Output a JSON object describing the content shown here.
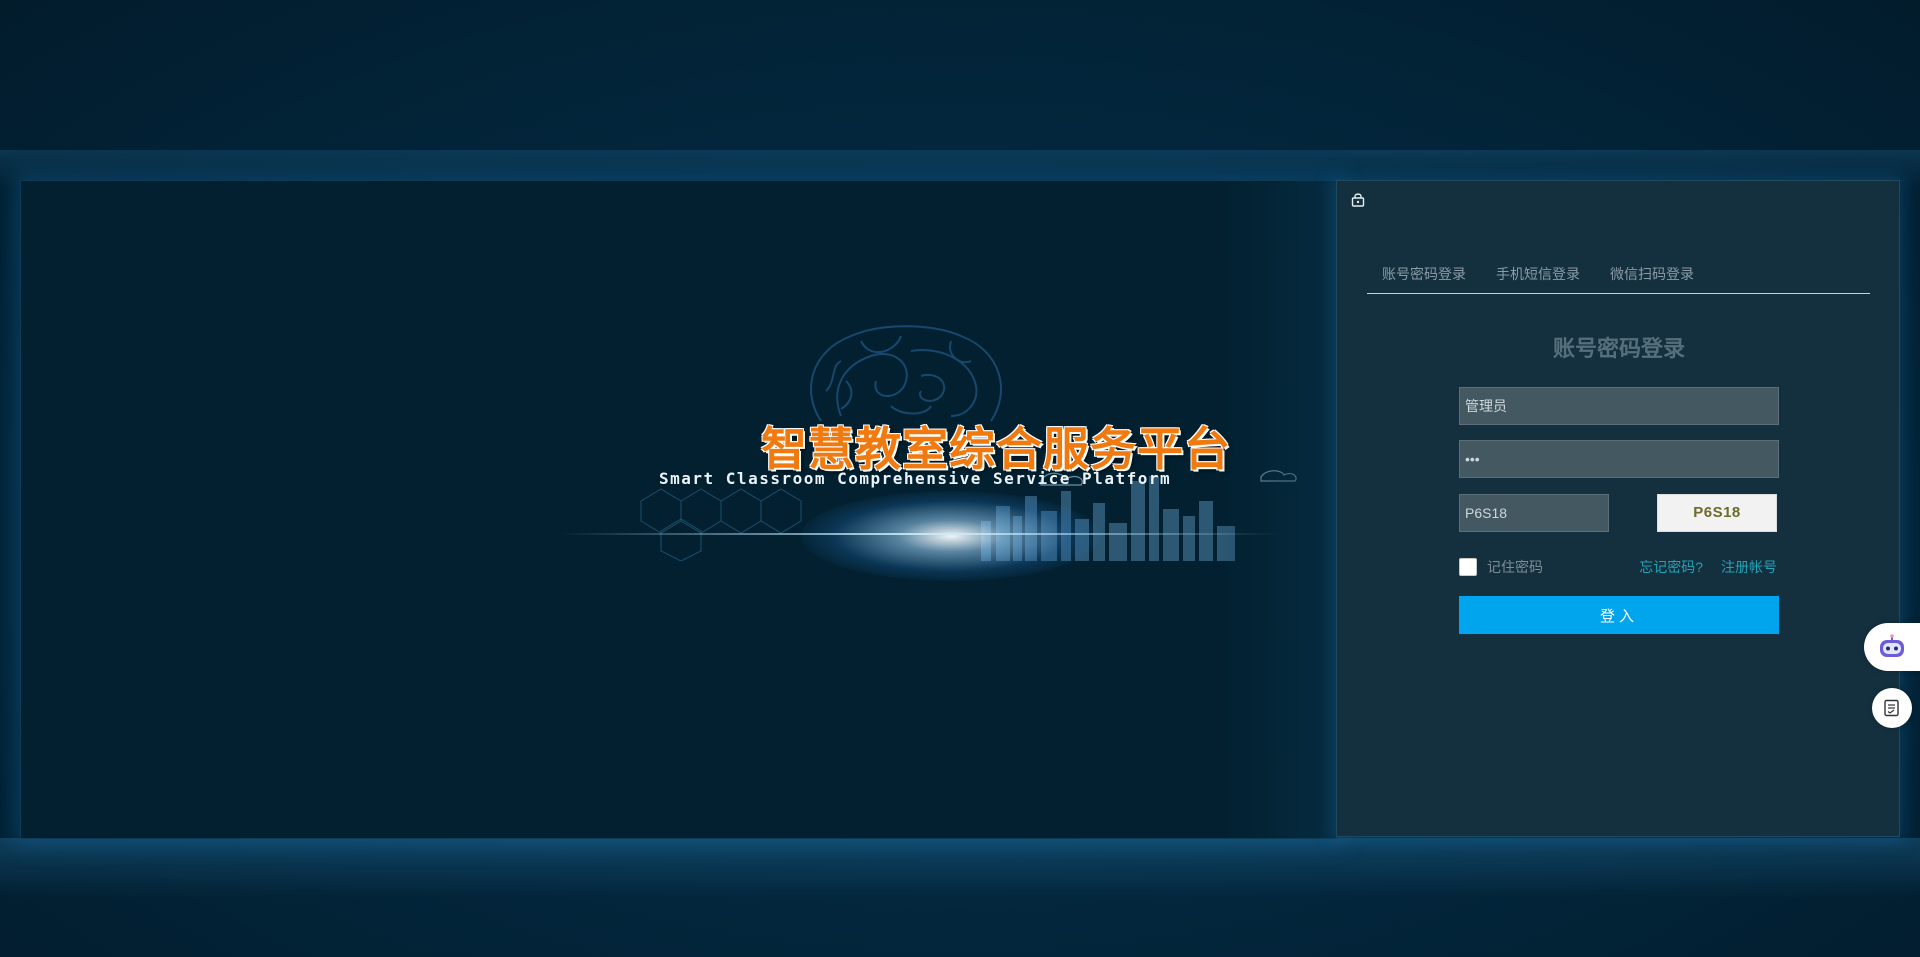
{
  "banner": {
    "title": "智慧教室综合服务平台",
    "subtitle": "Smart Classroom Comprehensive Service Platform"
  },
  "login": {
    "tabs": [
      {
        "label": "账号密码登录"
      },
      {
        "label": "手机短信登录"
      },
      {
        "label": "微信扫码登录"
      }
    ],
    "form_title": "账号密码登录",
    "username_value": "管理员",
    "password_value": "•••",
    "captcha_input_value": "P6S18",
    "captcha_image_text": "P6S18",
    "remember_label": "记住密码",
    "forgot_label": "忘记密码?",
    "register_label": "注册帐号",
    "submit_label": "登入"
  },
  "icons": {
    "lock": "lock-icon",
    "robot": "robot-icon",
    "doc": "document-icon"
  },
  "colors": {
    "title_orange": "#f07a10",
    "button_blue": "#00a5ee",
    "link_teal": "#22a3b6"
  }
}
